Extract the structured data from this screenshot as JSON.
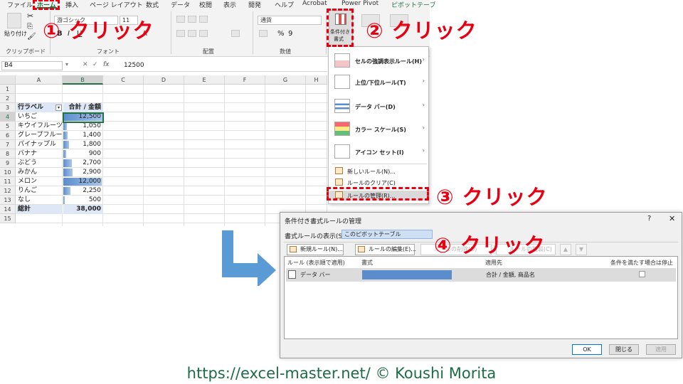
{
  "ribbon": {
    "tabs": [
      "ファイル",
      "ホーム",
      "挿入",
      "ページ レイアウト",
      "数式",
      "データ",
      "校閲",
      "表示",
      "開発",
      "ヘルプ",
      "Acrobat",
      "Power Pivot",
      "ピボットテーブ"
    ],
    "active_tab": "ホーム",
    "paste_label": "貼り付け",
    "groups": [
      "クリップボード",
      "フォント",
      "配置",
      "数値"
    ],
    "font_name": "游ゴシック",
    "number_format": "通貨",
    "number_symbols": [
      "%",
      "9"
    ],
    "cf_button": [
      "条件付き",
      "書式"
    ],
    "table_button": "テーブル として書式設定",
    "cell_style_button": "セルのスタイル"
  },
  "formula_bar": {
    "name_box": "B4",
    "fx": "fx",
    "value": "12500"
  },
  "grid": {
    "columns": [
      "A",
      "B",
      "C",
      "D",
      "E",
      "F",
      "G",
      "H"
    ],
    "rows": [
      "1",
      "2",
      "3",
      "4",
      "5",
      "6",
      "7",
      "8",
      "9",
      "10",
      "11",
      "12",
      "13",
      "14",
      "15"
    ],
    "header": {
      "label": "行ラベル",
      "value": "合計 / 金額"
    },
    "data": [
      {
        "label": "いちご",
        "value": "12,500",
        "fraction": 1.0
      },
      {
        "label": "キウイフルーツ",
        "value": "1,050",
        "fraction": 0.084
      },
      {
        "label": "グレープフルーツ",
        "value": "1,400",
        "fraction": 0.112
      },
      {
        "label": "パイナップル",
        "value": "1,800",
        "fraction": 0.144
      },
      {
        "label": "バナナ",
        "value": "900",
        "fraction": 0.072
      },
      {
        "label": "ぶどう",
        "value": "2,700",
        "fraction": 0.216
      },
      {
        "label": "みかん",
        "value": "2,900",
        "fraction": 0.232
      },
      {
        "label": "メロン",
        "value": "12,000",
        "fraction": 0.96
      },
      {
        "label": "りんご",
        "value": "2,250",
        "fraction": 0.18
      },
      {
        "label": "なし",
        "value": "500",
        "fraction": 0.04
      }
    ],
    "total": {
      "label": "総計",
      "value": "38,000"
    }
  },
  "cf_menu": {
    "items": [
      {
        "label": "セルの強調表示ルール(H)",
        "chev": "›"
      },
      {
        "label": "上位/下位ルール(T)",
        "chev": "›"
      },
      {
        "label": "データ バー(D)",
        "chev": "›"
      },
      {
        "label": "カラー スケール(S)",
        "chev": "›"
      },
      {
        "label": "アイコン セット(I)",
        "chev": "›"
      }
    ],
    "sub_items": [
      "新しいルール(N)...",
      "ルールのクリア(C)",
      "ルールの管理(R)..."
    ]
  },
  "callouts": [
    "① クリック",
    "② クリック",
    "③ クリック",
    "④ クリック"
  ],
  "dialog": {
    "title": "条件付き書式ルールの管理",
    "help": "?",
    "close": "✕",
    "show_label": "書式ルールの表示(S):",
    "show_value": "このピボットテーブル",
    "toolbar": {
      "new_rule": "新規ルール(N)...",
      "edit_rule": "ルールの編集(E)...",
      "delete_rule": "ルールの削除(D)",
      "duplicate_rule": "ルールの複製(C)",
      "up": "▲",
      "down": "▼"
    },
    "columns": [
      "ルール (表示順で適用)",
      "書式",
      "適用先",
      "条件を満たす場合は停止"
    ],
    "rule": {
      "type": "データ バー",
      "applies_to": "合計 / 金額, 商品名"
    },
    "buttons": {
      "ok": "OK",
      "close": "閉じる",
      "apply": "適用"
    }
  },
  "footer": "https://excel-master.net/  © Koushi Morita",
  "colors": {
    "accent_red": "#e60012",
    "databar": "#5b8ccc",
    "excel_green": "#217346",
    "arrow_blue": "#5b9bd5",
    "footer_green": "#1e6b47"
  }
}
